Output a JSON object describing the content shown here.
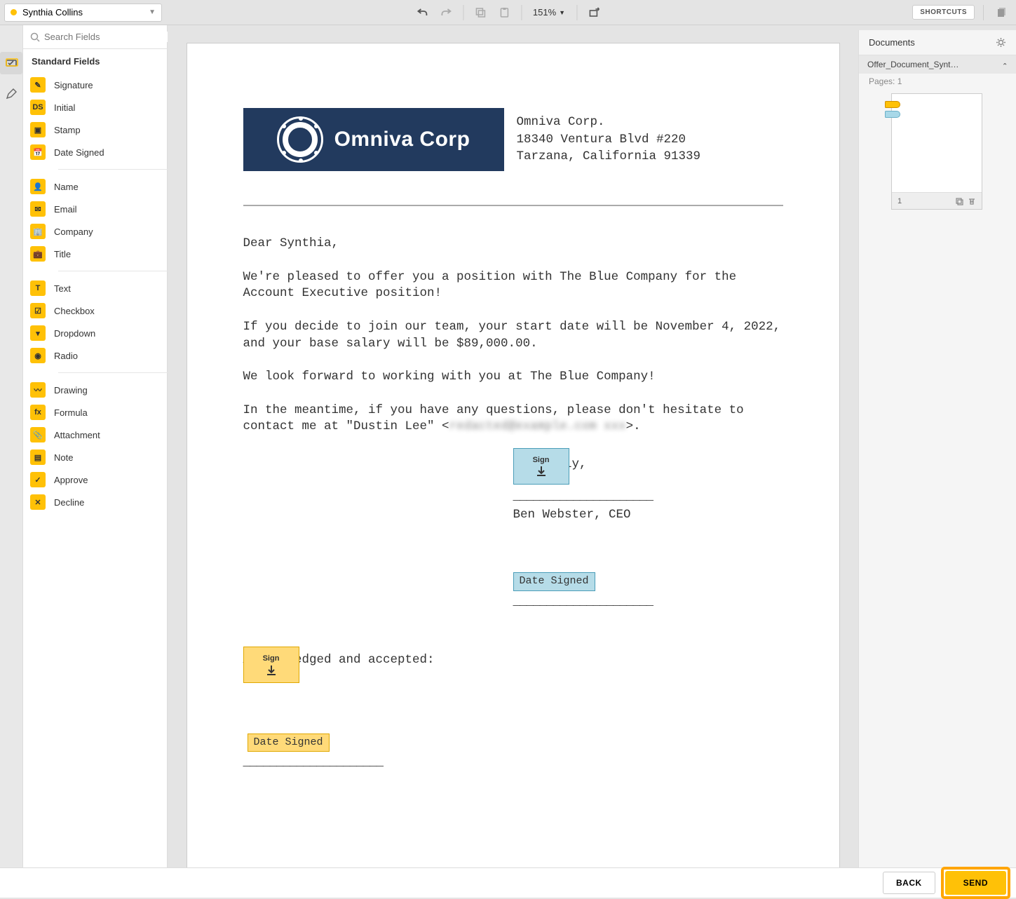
{
  "toolbar": {
    "recipient_name": "Synthia Collins",
    "zoom": "151%",
    "shortcuts_label": "SHORTCUTS"
  },
  "search": {
    "placeholder": "Search Fields"
  },
  "fields_panel": {
    "header": "Standard Fields",
    "groups": [
      {
        "items": [
          {
            "icon": "✎",
            "label": "Signature"
          },
          {
            "icon": "DS",
            "label": "Initial"
          },
          {
            "icon": "▣",
            "label": "Stamp"
          },
          {
            "icon": "📅",
            "label": "Date Signed"
          }
        ]
      },
      {
        "items": [
          {
            "icon": "👤",
            "label": "Name"
          },
          {
            "icon": "✉",
            "label": "Email"
          },
          {
            "icon": "🏢",
            "label": "Company"
          },
          {
            "icon": "💼",
            "label": "Title"
          }
        ]
      },
      {
        "items": [
          {
            "icon": "T",
            "label": "Text"
          },
          {
            "icon": "☑",
            "label": "Checkbox"
          },
          {
            "icon": "▾",
            "label": "Dropdown"
          },
          {
            "icon": "◉",
            "label": "Radio"
          }
        ]
      },
      {
        "items": [
          {
            "icon": "〰",
            "label": "Drawing"
          },
          {
            "icon": "fx",
            "label": "Formula"
          },
          {
            "icon": "📎",
            "label": "Attachment"
          },
          {
            "icon": "▤",
            "label": "Note"
          },
          {
            "icon": "✓",
            "label": "Approve"
          },
          {
            "icon": "✕",
            "label": "Decline"
          }
        ]
      }
    ]
  },
  "document": {
    "company_name": "Omniva Corp.",
    "company_logo_text": "Omniva Corp",
    "address_line1": "18340 Ventura Blvd #220",
    "address_line2": "Tarzana, California 91339",
    "greeting": "Dear Synthia,",
    "para1": "We're pleased to offer you a position with The Blue Company for the Account Executive position!",
    "para2": "If you decide to join our team, your start date will be November 4, 2022, and your base salary will be $89,000.00.",
    "para3": "We look forward to working with you at The Blue Company!",
    "para4_pre": "In the meantime, if you have any questions, please don't hesitate to contact me at \"Dustin Lee\" <",
    "para4_blur": "redacted@example.com xxx",
    "para4_post": ">.",
    "sincerely": "Sincerely,",
    "sig_line": "_____________________",
    "signer_name": "Ben Webster, CEO",
    "date_signed_label": "Date Signed",
    "acknowledged": "Acknowledged and accepted:",
    "sign_label": "Sign"
  },
  "right_panel": {
    "title": "Documents",
    "doc_name": "Offer_Document_Synt…",
    "pages_label": "Pages: 1",
    "page_num": "1"
  },
  "footer": {
    "back": "BACK",
    "send": "SEND"
  }
}
